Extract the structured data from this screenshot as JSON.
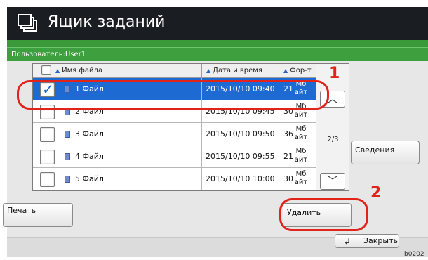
{
  "window": {
    "title": "Ящик заданий"
  },
  "user_bar": {
    "label": "Пользователь:",
    "value": "User1"
  },
  "table": {
    "columns": [
      {
        "label": "Имя файла"
      },
      {
        "label": "Дата и время"
      },
      {
        "label": "Фор-т"
      }
    ],
    "rows": [
      {
        "name": "1 Файл",
        "datetime": "2015/10/10 09:40",
        "size": "21",
        "unit": "Мб айт",
        "selected": true
      },
      {
        "name": "2 Файл",
        "datetime": "2015/10/10 09:45",
        "size": "30",
        "unit": "Мб айт",
        "selected": false
      },
      {
        "name": "3 Файл",
        "datetime": "2015/10/10 09:50",
        "size": "36",
        "unit": "Мб айт",
        "selected": false
      },
      {
        "name": "4 Файл",
        "datetime": "2015/10/10 09:55",
        "size": "21",
        "unit": "Мб айт",
        "selected": false
      },
      {
        "name": "5 Файл",
        "datetime": "2015/10/10 10:00",
        "size": "30",
        "unit": "Мб айт",
        "selected": false
      }
    ]
  },
  "pager": {
    "indicator": "2/3",
    "up_icon": "chevron-up-icon",
    "down_icon": "chevron-down-icon"
  },
  "buttons": {
    "print": "Печать",
    "details": "Сведения",
    "delete": "Удалить",
    "close": "Закрыть"
  },
  "callouts": {
    "one": "1",
    "two": "2"
  },
  "footer": {
    "ref": "b0202"
  },
  "colors": {
    "titlebar": "#1a1d22",
    "accent_green": "#3e9f3e",
    "selection": "#1e6ad3",
    "callout": "#e2231a"
  }
}
